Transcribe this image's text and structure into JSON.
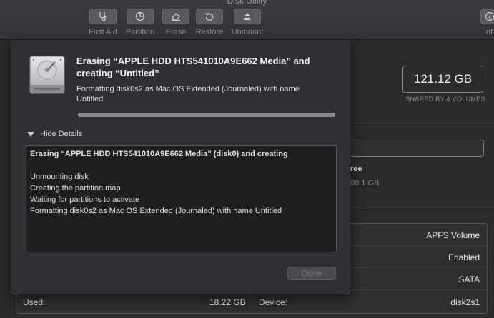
{
  "window": {
    "title": "Disk Utility"
  },
  "toolbar": {
    "buttons": [
      {
        "label": "First Aid",
        "icon": "stethoscope-icon"
      },
      {
        "label": "Partition",
        "icon": "pie-chart-icon"
      },
      {
        "label": "Erase",
        "icon": "eraser-icon"
      },
      {
        "label": "Restore",
        "icon": "restore-icon"
      },
      {
        "label": "Unmount",
        "icon": "eject-icon"
      }
    ],
    "info_label": "Inf"
  },
  "volume_summary": {
    "capacity": "121.12 GB",
    "shared": "SHARED BY 4 VOLUMES",
    "free_title": "ree",
    "free_value": "00.1 GB"
  },
  "info_table": {
    "rows": [
      {
        "right_value": "APFS Volume"
      },
      {
        "right_value": "Enabled"
      },
      {
        "right_value": "SATA"
      },
      {
        "left_label": "Used:",
        "left_value": "18.22 GB",
        "right_label": "Device:",
        "right_value": "disk2s1"
      }
    ]
  },
  "sheet": {
    "title": "Erasing “APPLE HDD HTS541010A9E662 Media” and creating “Untitled”",
    "subtitle": "Formatting disk0s2 as Mac OS Extended (Journaled) with name Untitled",
    "progress": 1.0,
    "details_toggle": "Hide Details",
    "log_lines": [
      "Erasing “APPLE HDD HTS541010A9E662 Media” (disk0) and creating",
      "",
      "Unmounting disk",
      "Creating the partition map",
      "Waiting for partitions to activate",
      "Formatting disk0s2 as Mac OS Extended (Journaled) with name Untitled"
    ],
    "done_label": "Done"
  }
}
